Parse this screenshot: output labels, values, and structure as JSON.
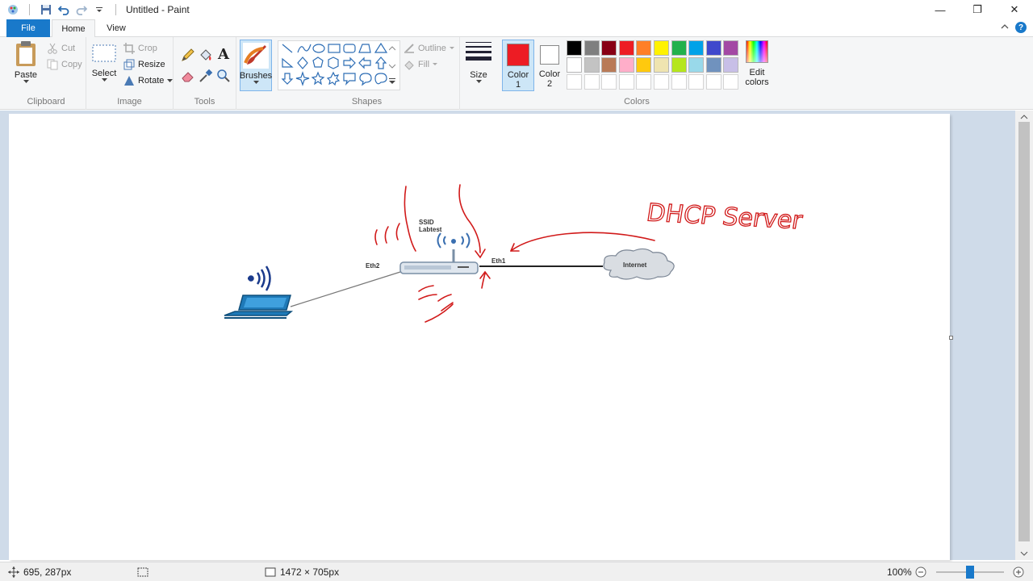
{
  "window": {
    "title": "Untitled - Paint",
    "controls": {
      "minimize": "—",
      "maximize": "❐",
      "close": "✕"
    }
  },
  "ribbon_tabs": {
    "file": "File",
    "home": "Home",
    "view": "View"
  },
  "clipboard": {
    "paste": "Paste",
    "cut": "Cut",
    "copy": "Copy",
    "label": "Clipboard"
  },
  "image_group": {
    "select": "Select",
    "crop": "Crop",
    "resize": "Resize",
    "rotate": "Rotate",
    "label": "Image"
  },
  "tools_group": {
    "label": "Tools",
    "text_tool": "A"
  },
  "brushes": {
    "label": "Brushes"
  },
  "shapes_group": {
    "outline": "Outline",
    "fill": "Fill",
    "label": "Shapes"
  },
  "size": {
    "label": "Size"
  },
  "colors_group": {
    "color1_line1": "Color",
    "color1_line2": "1",
    "color2_line1": "Color",
    "color2_line2": "2",
    "edit_line1": "Edit",
    "edit_line2": "colors",
    "label": "Colors",
    "color1": "#ed1c24",
    "color2": "#ffffff",
    "palette_row1": [
      "#000000",
      "#7f7f7f",
      "#880015",
      "#ed1c24",
      "#ff7f27",
      "#fff200",
      "#22b14c",
      "#00a2e8",
      "#3f48cc",
      "#a349a4"
    ],
    "palette_row2": [
      "#ffffff",
      "#c3c3c3",
      "#b97a57",
      "#ffaec9",
      "#ffc90e",
      "#efe4b0",
      "#b5e61d",
      "#99d9ea",
      "#7092be",
      "#c8bfe7"
    ]
  },
  "drawing": {
    "ssid_line1": "SSID",
    "ssid_line2": "Labtest",
    "eth2": "Eth2",
    "eth1": "Eth1",
    "internet": "Internet",
    "annotation": "DHCP Server"
  },
  "status": {
    "cursor": "695, 287px",
    "canvas_size": "1472 × 705px",
    "zoom": "100%"
  }
}
